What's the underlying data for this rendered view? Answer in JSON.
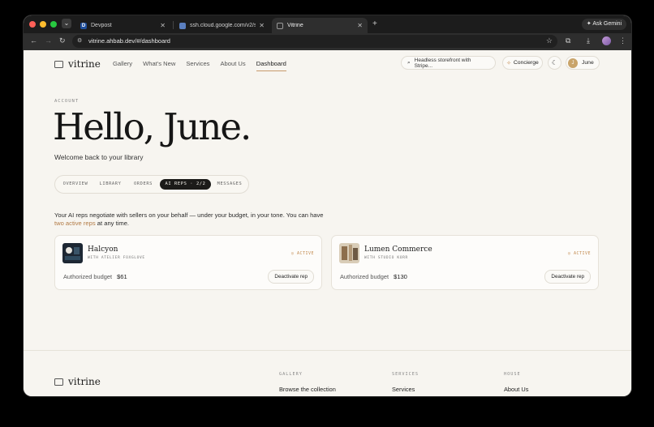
{
  "browser": {
    "tabs": [
      {
        "title": "Devpost",
        "favicon": "D"
      },
      {
        "title": "ssh.cloud.google.com/v2/ssh/",
        "favicon": "ssh-terminal-icon"
      },
      {
        "title": "Vitrine",
        "favicon": "vitrine-icon"
      }
    ],
    "gemini_label": "Ask Gemini",
    "url": "vitrine.ahbab.dev/#/dashboard"
  },
  "site": {
    "logo": "vitrine",
    "nav": [
      "Gallery",
      "What's New",
      "Services",
      "About Us",
      "Dashboard"
    ],
    "active_nav": "Dashboard",
    "search_value": "Headless storefront with Stripe...",
    "concierge_label": "Concierge",
    "user_initial": "J",
    "user_name": "June"
  },
  "hero": {
    "eyebrow": "ACCOUNT",
    "title": "Hello, June.",
    "subtitle": "Welcome back to your library"
  },
  "tabs": [
    "OVERVIEW",
    "LIBRARY",
    "ORDERS",
    "AI REPS · 2/2",
    "MESSAGES"
  ],
  "active_tab": "AI REPS · 2/2",
  "intro": {
    "text_before": "Your AI reps negotiate with sellers on your behalf — under your budget, in your tone. You can have",
    "link": "two active reps",
    "text_after": "at any time."
  },
  "reps": [
    {
      "name": "Halcyon",
      "studio": "WITH ATELIER FOXGLOVE",
      "status": "ACTIVE",
      "budget_label": "Authorized budget",
      "budget": "$61",
      "action": "Deactivate rep"
    },
    {
      "name": "Lumen Commerce",
      "studio": "WITH STUDIO KORR",
      "status": "ACTIVE",
      "budget_label": "Authorized budget",
      "budget": "$130",
      "action": "Deactivate rep"
    }
  ],
  "footer": {
    "logo": "vitrine",
    "columns": [
      {
        "heading": "GALLERY",
        "link": "Browse the collection"
      },
      {
        "heading": "SERVICES",
        "link": "Services"
      },
      {
        "heading": "HOUSE",
        "link": "About Us"
      }
    ]
  },
  "colors": {
    "accent": "#c79b6d",
    "active_status": "#c28a4f",
    "dark_tab": "#1c1b19"
  }
}
